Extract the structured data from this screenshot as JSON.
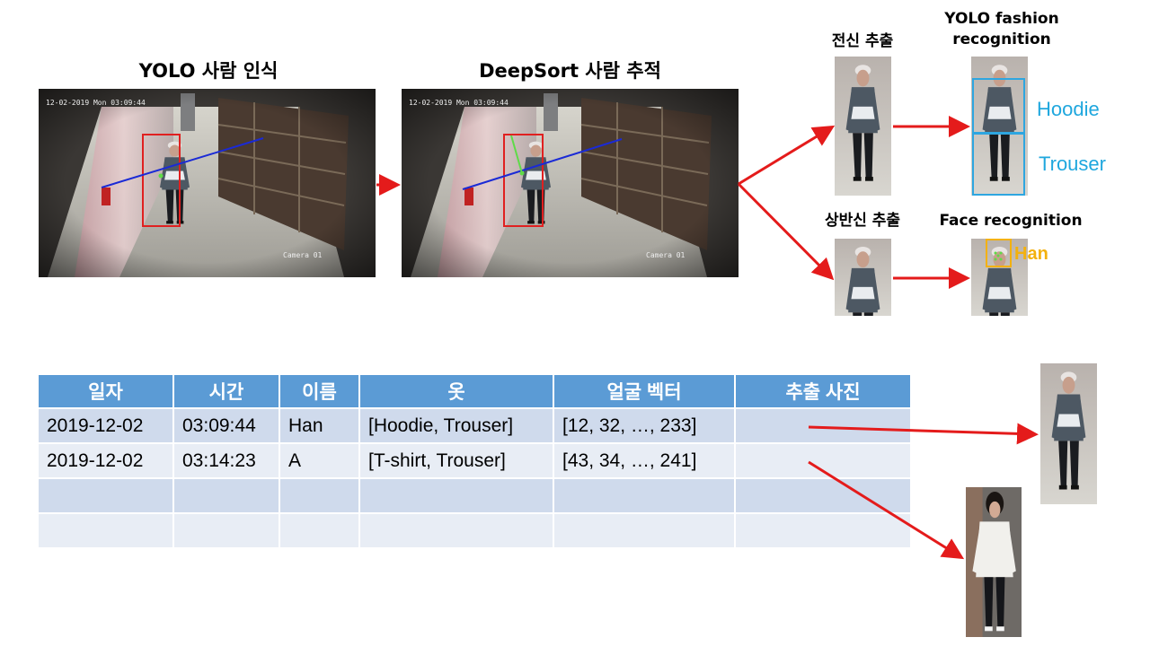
{
  "panels": {
    "yolo_title": "YOLO 사람 인식",
    "deepsort_title": "DeepSort 사람 추적",
    "cam_timestamp": "12-02-2019 Mon 03:09:44",
    "cam_label": "Camera 01"
  },
  "extract": {
    "full_body": "전신 추출",
    "upper_body": "상반신 추출"
  },
  "recognition": {
    "fashion_title_line1": "YOLO fashion",
    "fashion_title_line2": "recognition",
    "face_title": "Face recognition",
    "hoodie_label": "Hoodie",
    "trouser_label": "Trouser",
    "face_name": "Han"
  },
  "table": {
    "headers": [
      "일자",
      "시간",
      "이름",
      "옷",
      "얼굴 벡터",
      "추출 사진"
    ],
    "rows": [
      [
        "2019-12-02",
        "03:09:44",
        "Han",
        "[Hoodie, Trouser]",
        "[12, 32, …, 233]",
        ""
      ],
      [
        "2019-12-02",
        "03:14:23",
        "A",
        "[T-shirt, Trouser]",
        "[43, 34, …, 241]",
        ""
      ],
      [
        "",
        "",
        "",
        "",
        "",
        ""
      ],
      [
        "",
        "",
        "",
        "",
        "",
        ""
      ]
    ]
  },
  "colors": {
    "arrow": "#e41b1b",
    "header_bg": "#5b9bd5",
    "row_odd": "#cfdaec",
    "row_even": "#e8edf5",
    "bbox_red": "#e02020",
    "track_line": "#1a2ad6",
    "fashion_box": "#2ea6e0",
    "face_box": "#f3b10e"
  }
}
